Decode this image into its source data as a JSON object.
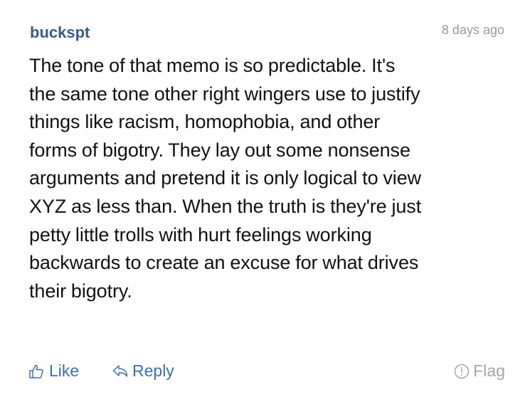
{
  "comment": {
    "username": "buckspt",
    "timestamp": "8 days ago",
    "body_lines": [
      "The tone of that memo is so predictable. It's",
      "the same tone other right wingers use to justify",
      "things like racism, homophobia, and other",
      "forms of bigotry. They lay out some nonsense",
      "arguments and pretend it is only logical to view",
      "XYZ as less than. When the truth is they're just",
      "petty little trolls with hurt feelings working",
      "backwards to create an excuse for what drives",
      "their bigotry."
    ]
  },
  "actions": {
    "like_label": "Like",
    "reply_label": "Reply",
    "flag_label": "Flag"
  },
  "icons": {
    "like": "thumbs-up-icon",
    "reply": "reply-arrow-icon",
    "flag": "exclamation-circle-icon"
  },
  "colors": {
    "username": "#3a5a86",
    "timestamp": "#9a9a9a",
    "body_text": "#111111",
    "action_link": "#3f6fae",
    "flag": "#a5a5a5"
  }
}
